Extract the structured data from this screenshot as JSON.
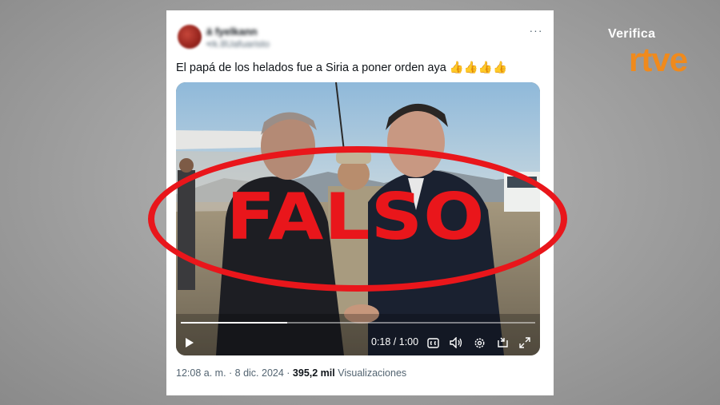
{
  "tweet": {
    "user_name": "ä fyelkann",
    "user_handle": "•rk.8Uafuaristo",
    "more_label": "···",
    "text": "El papá de los helados fue a Siria a poner orden aya 👍👍👍👍"
  },
  "video": {
    "time": "0:18 / 1:00",
    "progress_fraction": 0.3
  },
  "stamp": {
    "label": "FALSO"
  },
  "footer": {
    "timestamp": "12:08 a. m. · 8 dic. 2024 · ",
    "views_count": "395,2 mil",
    "views_label": " Visualizaciones"
  },
  "brand": {
    "verifica": "Verifica",
    "rtve": "rtve"
  },
  "colors": {
    "stamp_red": "#e9161b",
    "rtve_orange": "#f08a1c",
    "text_dark": "#0f1419",
    "text_muted": "#536471"
  }
}
